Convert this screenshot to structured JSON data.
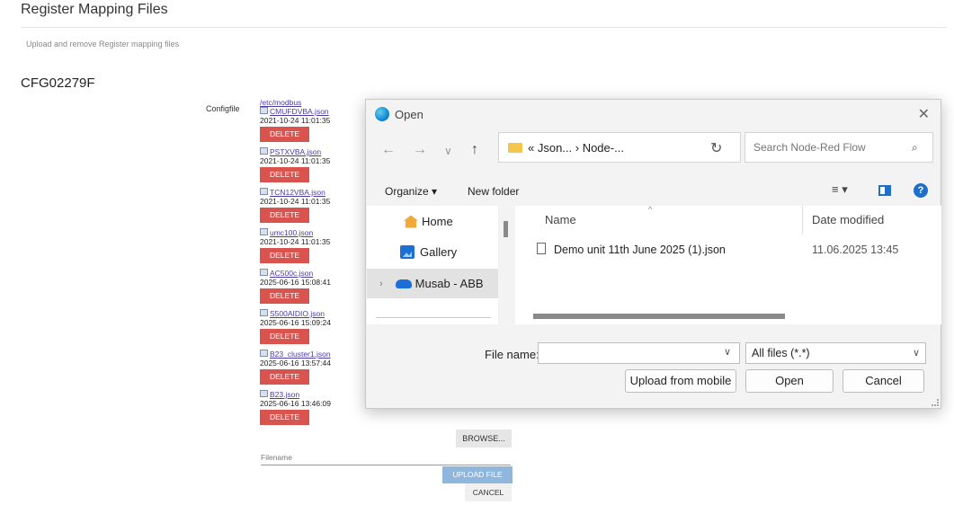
{
  "page": {
    "title": "Register Mapping Files",
    "subtitle": "Upload and remove Register mapping files",
    "device": "CFG02279F",
    "configfile_label": "Configfile",
    "directory": "/etc/modbus",
    "delete_label": "DELETE",
    "files": [
      {
        "name": "CMUFDVBA.json",
        "date": "2021-10-24 11:01:35"
      },
      {
        "name": "PSTXVBA.json",
        "date": "2021-10-24 11:01:35"
      },
      {
        "name": "TCN12VBA.json",
        "date": "2021-10-24 11:01:35"
      },
      {
        "name": "umc100.json",
        "date": "2021-10-24 11:01:35"
      },
      {
        "name": "AC500c.json",
        "date": "2025-06-16 15:08:41"
      },
      {
        "name": "S500AIDIO.json",
        "date": "2025-06-16 15:09:24"
      },
      {
        "name": "B23_cluster1.json",
        "date": "2025-06-16 13:57:44"
      },
      {
        "name": "B23.json",
        "date": "2025-06-16 13:46:09"
      }
    ],
    "browse_label": "BROWSE...",
    "filename_label": "Filename",
    "upload_label": "UPLOAD FILE",
    "cancel_label": "CANCEL"
  },
  "dialog": {
    "title": "Open",
    "close_glyph": "✕",
    "back_glyph": "←",
    "forward_glyph": "→",
    "recent_glyph": "∨",
    "up_glyph": "↑",
    "address_path": "« Json... › Node-...",
    "address_chevron": "∨",
    "refresh_glyph": "↻",
    "search_placeholder": "Search Node-Red Flow",
    "search_glyph": "⌕",
    "organize_label": "Organize ▾",
    "new_folder_label": "New folder",
    "view_glyph": "≡ ▾",
    "help_glyph": "?",
    "nav_items": [
      {
        "label": "Home",
        "icon": "home-icon"
      },
      {
        "label": "Gallery",
        "icon": "gallery-icon"
      },
      {
        "label": "Musab - ABB",
        "icon": "onedrive-icon"
      }
    ],
    "nav_expand_glyph": "›",
    "columns": {
      "name": "Name",
      "date": "Date modified",
      "sort_glyph": "^"
    },
    "rows": [
      {
        "name": "Demo unit 11th June 2025 (1).json",
        "date": "11.06.2025 13:45"
      }
    ],
    "file_name_label": "File name:",
    "file_name_value": "",
    "file_name_chevron": "∨",
    "filter_value": "All files (*.*)",
    "filter_chevron": "∨",
    "upload_mobile_label": "Upload from mobile",
    "open_label": "Open",
    "cancel_label": "Cancel",
    "colors": {
      "accent": "#1e6fc9",
      "folder": "#f4c64a",
      "delete": "#d9534f"
    }
  }
}
